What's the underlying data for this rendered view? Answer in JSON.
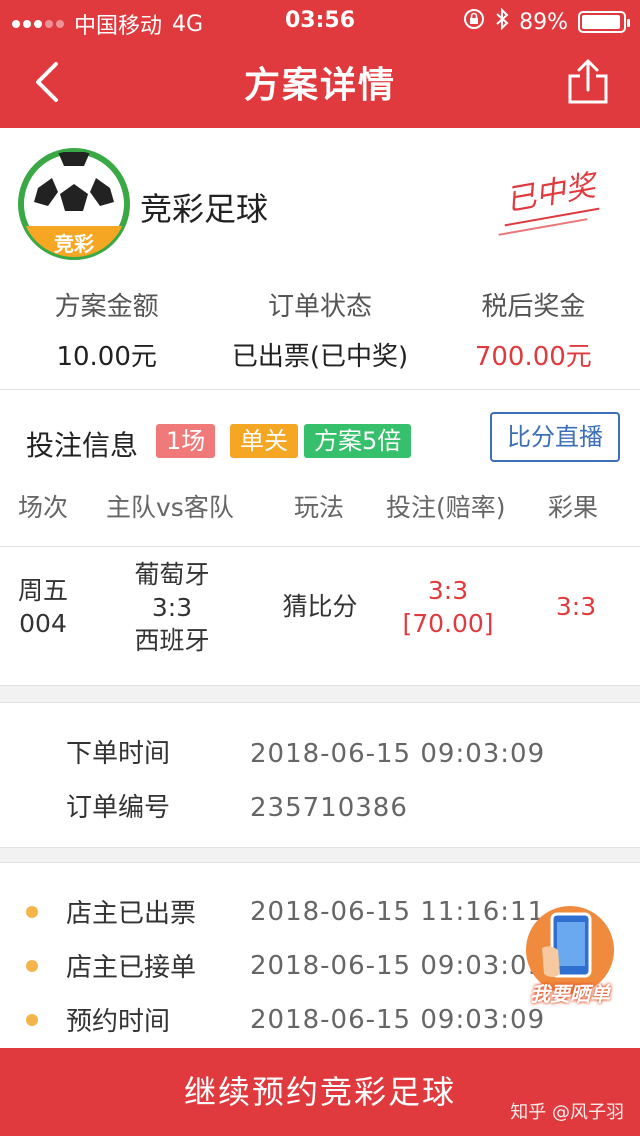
{
  "status_bar": {
    "carrier": "中国移动",
    "network": "4G",
    "time": "03:56",
    "battery": "89%"
  },
  "nav": {
    "title": "方案详情"
  },
  "lottery": {
    "name": "竞彩足球",
    "logo_badge": "竞彩",
    "stamp": "已中奖"
  },
  "summary": {
    "items": [
      {
        "label": "方案金额",
        "value": "10.00元"
      },
      {
        "label": "订单状态",
        "value": "已出票(已中奖)"
      },
      {
        "label": "税后奖金",
        "value": "700.00元"
      }
    ]
  },
  "bet_info": {
    "title": "投注信息",
    "tags": [
      "1场",
      "单关",
      "方案5倍"
    ],
    "live_button": "比分直播",
    "columns": [
      "场次",
      "主队vs客队",
      "玩法",
      "投注(赔率)",
      "彩果"
    ],
    "rows": [
      {
        "session_day": "周五",
        "session_no": "004",
        "home": "葡萄牙",
        "score": "3:3",
        "away": "西班牙",
        "play": "猜比分",
        "bet": "3:3",
        "odds": "[70.00]",
        "result": "3:3"
      }
    ]
  },
  "order": {
    "items": [
      {
        "label": "下单时间",
        "value": "2018-06-15 09:03:09"
      },
      {
        "label": "订单编号",
        "value": "235710386"
      }
    ]
  },
  "timeline": {
    "items": [
      {
        "label": "店主已出票",
        "value": "2018-06-15 11:16:11"
      },
      {
        "label": "店主已接单",
        "value": "2018-06-15 09:03:09"
      },
      {
        "label": "预约时间",
        "value": "2018-06-15 09:03:09"
      }
    ]
  },
  "share_float": {
    "label": "我要晒单"
  },
  "bottom": {
    "button": "继续预约竞彩足球",
    "watermark": "知乎 @风子羽"
  },
  "colors": {
    "brand_red": "#e03a3e",
    "link_blue": "#3d6fb8",
    "tag_pink": "#f07a7a",
    "tag_orange": "#f5a623",
    "tag_green": "#37c06b",
    "timeline_dot": "#f5b44a"
  }
}
